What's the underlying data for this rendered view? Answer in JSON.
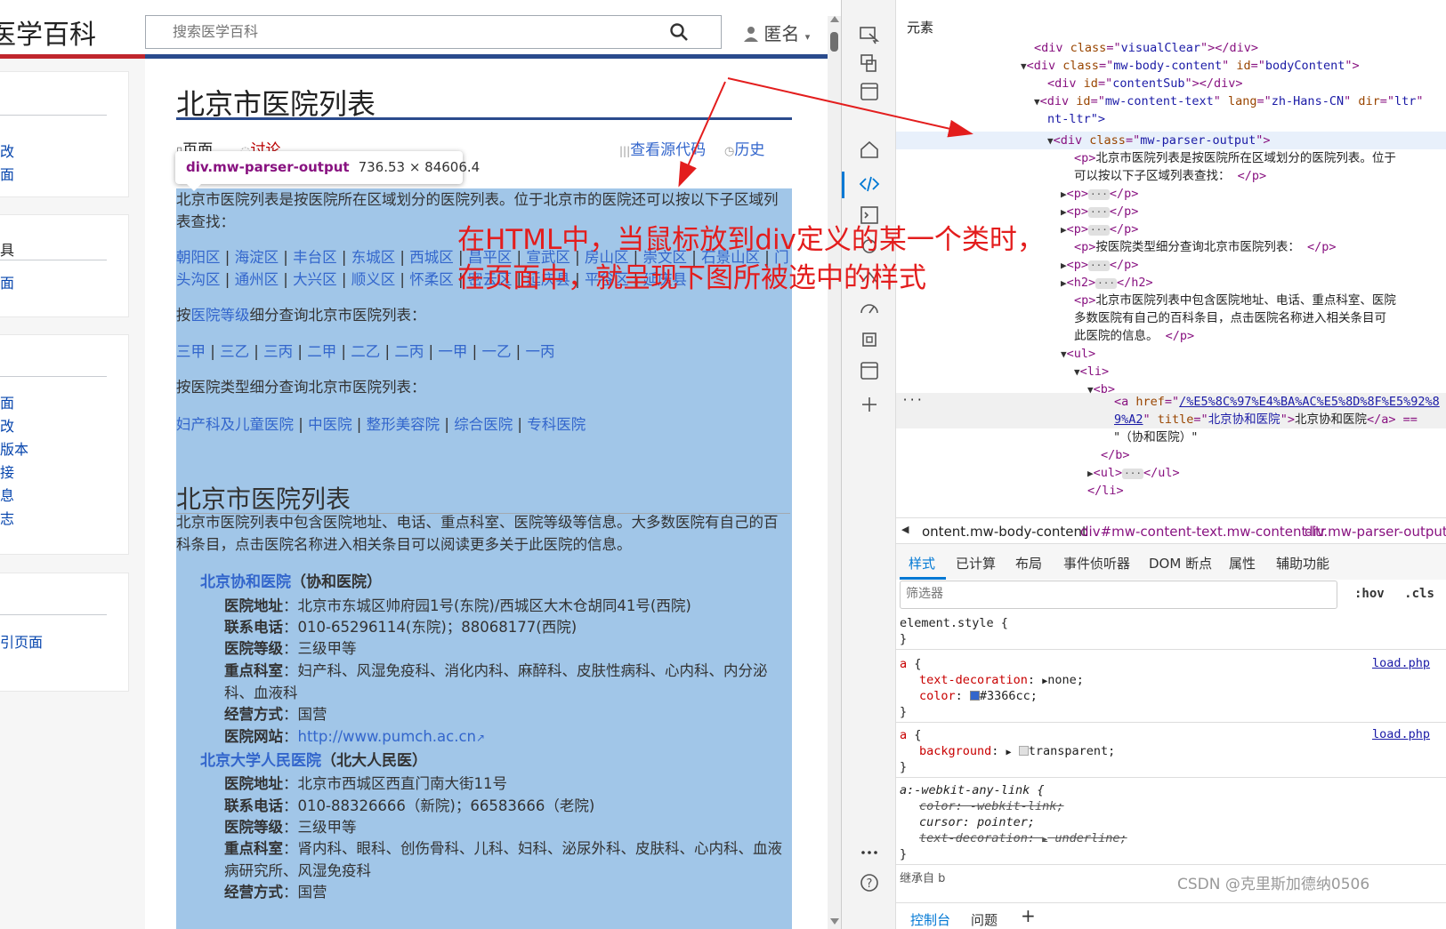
{
  "site": {
    "logo": "医学百科",
    "search_placeholder": "搜索医学百科",
    "user": "匿名"
  },
  "sidebar": {
    "box1": [
      "改",
      "面"
    ],
    "box2": {
      "head": "具",
      "items": [
        "面"
      ]
    },
    "box3": [
      "面",
      "改",
      "版本",
      "接",
      "息",
      "志"
    ],
    "box4": [
      "引页面"
    ]
  },
  "page": {
    "title": "北京市医院列表",
    "tab_page": "页面",
    "tab_talk": "讨论",
    "tab_source": "查看源代码",
    "tab_history": "历史"
  },
  "tooltip": {
    "name": "div.mw-parser-output",
    "size": "736.53 × 84606.4"
  },
  "content": {
    "intro": "北京市医院列表是按医院所在区域划分的医院列表。位于北京市的医院还可以按以下子区域列表查找：",
    "districts": [
      "朝阳区",
      "海淀区",
      "丰台区",
      "东城区",
      "西城区",
      "昌平区",
      "宣武区",
      "房山区",
      "崇文区",
      "石景山区",
      "门头沟区",
      "通州区",
      "大兴区",
      "顺义区",
      "怀柔区",
      "密云区",
      "延庆县",
      "平谷区",
      "延庆县"
    ],
    "grade_intro_pre": "按",
    "grade_intro_link": "医院等级",
    "grade_intro_post": "细分查询北京市医院列表：",
    "grades": [
      "三甲",
      "三乙",
      "三丙",
      "二甲",
      "二乙",
      "二丙",
      "一甲",
      "一乙",
      "一丙"
    ],
    "type_intro": "按医院类型细分查询北京市医院列表：",
    "types": [
      "妇产科及儿童医院",
      "中医院",
      "整形美容院",
      "综合医院",
      "专科医院"
    ],
    "h2": "北京市医院列表",
    "h2_intro": "北京市医院列表中包含医院地址、电话、重点科室、医院等级等信息。大多数医院有自己的百科条目，点击医院名称进入相关条目可以阅读更多关于此医院的信息。",
    "hospitals": [
      {
        "name": "北京协和医院",
        "alias": "（协和医院）",
        "addr_label": "医院地址",
        "addr": "北京市东城区帅府园1号(东院)/西城区大木仓胡同41号(西院)",
        "phone_label": "联系电话",
        "phone": "010-65296114(东院)；88068177(西院)",
        "grade_label": "医院等级",
        "grade": "三级甲等",
        "dept_label": "重点科室",
        "dept": "妇产科、风湿免疫科、消化内科、麻醉科、皮肤性病科、心内科、内分泌科、血液科",
        "mode_label": "经营方式",
        "mode": "国营",
        "web_label": "医院网站",
        "web": "http://www.pumch.ac.cn"
      },
      {
        "name": "北京大学人民医院",
        "alias": "（北大人民医）",
        "addr_label": "医院地址",
        "addr": "北京市西城区西直门南大街11号",
        "phone_label": "联系电话",
        "phone": "010-88326666（新院)；66583666（老院)",
        "grade_label": "医院等级",
        "grade": "三级甲等",
        "dept_label": "重点科室",
        "dept": "肾内科、眼科、创伤骨科、儿科、妇科、泌尿外科、皮肤科、心内科、血液病研究所、风湿免疫科",
        "mode_label": "经营方式",
        "mode": "国营"
      }
    ]
  },
  "annotation": {
    "line1": "在HTML中，当鼠标放到div定义的某一个类时，",
    "line2": "在页面中，就呈现下图所被选中的样式",
    "color": "#e31d1d"
  },
  "devtools": {
    "panel_title": "元素",
    "dom": {
      "l1_tag": "div",
      "l1_attr": "class",
      "l1_val": "visualClear",
      "l2_tag": "div",
      "l2_attr1": "class",
      "l2_val1": "mw-body-content",
      "l2_attr2": "id",
      "l2_val2": "bodyContent",
      "l3_tag": "div",
      "l3_attr": "id",
      "l3_val": "contentSub",
      "l4_tag": "div",
      "l4_attr1": "id",
      "l4_val1": "mw-content-text",
      "l4_attr2": "lang",
      "l4_val2": "zh-Hans-CN",
      "l4_attr3": "dir",
      "l4_val3": "ltr",
      "l4b": "nt-ltr\">",
      "l5_tag": "div",
      "l5_attr": "class",
      "l5_val": "mw-parser-output",
      "l6_text": "北京市医院列表是按医院所在区域划分的医院列表。位于",
      "l6b_text": "可以按以下子区域列表查找：",
      "p_type_text": "按医院类型细分查询北京市医院列表：",
      "p_long_text": "北京市医院列表中包含医院地址、电话、重点科室、医院",
      "p_long_text2": "多数医院有自己的百科条目，点击医院名称进入相关条目可",
      "p_long_text3": "此医院的信息。",
      "a_href": "/%E5%8C%97%E4%BA%AC%E5%8D%8F%E5%92%8",
      "a_href2": "9%A2",
      "a_title": "北京协和医院",
      "a_text": "北京协和医院",
      "b_tail": "\"（协和医院）\""
    },
    "crumbs": [
      "ontent.mw-body-content",
      "div#mw-content-text.mw-content-ltr",
      "div.mw-parser-output"
    ],
    "subtabs": [
      "样式",
      "已计算",
      "布局",
      "事件侦听器",
      "DOM 断点",
      "属性",
      "辅助功能"
    ],
    "filter_placeholder": "筛选器",
    "hov": ":hov",
    "cls": ".cls",
    "styles": {
      "element_style": "element.style {",
      "a_sel": "a {",
      "td_prop": "text-decoration",
      "td_val": "none;",
      "color_prop": "color",
      "color_val": "#3366cc;",
      "bg_prop": "background",
      "bg_val": "transparent;",
      "webkit_sel": "a:-webkit-any-link {",
      "w_color": "color: -webkit-link;",
      "w_cursor": "cursor: pointer;",
      "w_td": "text-decoration: ",
      "w_td_val": "underline;",
      "source": "load.php",
      "inherited": "继承自 b"
    },
    "bottom_tabs": [
      "控制台",
      "问题",
      "+"
    ],
    "swatch_color": "#3366cc"
  },
  "watermark": "CSDN @克里斯加德纳0506"
}
